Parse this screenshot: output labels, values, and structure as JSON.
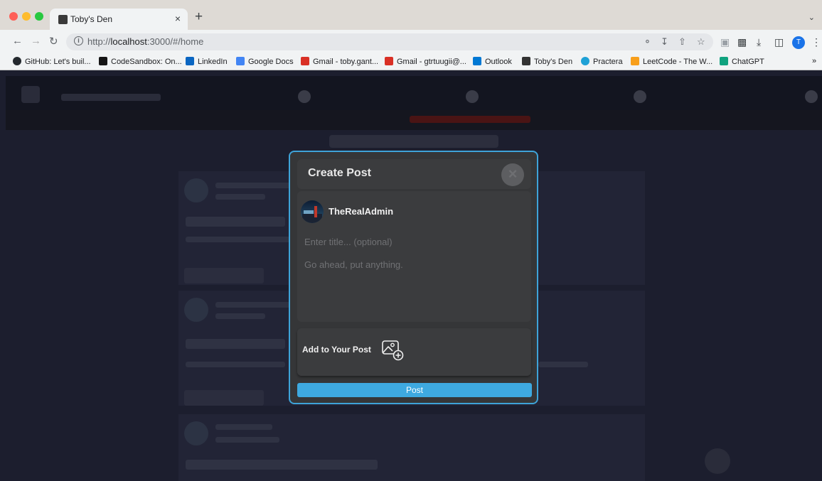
{
  "browser": {
    "tab_title": "Toby's Den",
    "tab_close": "×",
    "new_tab": "+",
    "url_prefix": "http://",
    "url_host": "localhost",
    "url_path": ":3000/#/home",
    "bookmarks": [
      {
        "label": "GitHub: Let's buil...",
        "icon": "github-icon",
        "color": "#24292e"
      },
      {
        "label": "CodeSandbox: On...",
        "icon": "codesandbox-icon",
        "color": "#151515"
      },
      {
        "label": "LinkedIn",
        "icon": "linkedin-icon",
        "color": "#0a66c2"
      },
      {
        "label": "Google Docs",
        "icon": "google-docs-icon",
        "color": "#4285f4"
      },
      {
        "label": "Gmail - toby.gant...",
        "icon": "gmail-icon",
        "color": "#d93025"
      },
      {
        "label": "Gmail - gtrtuugii@...",
        "icon": "gmail-icon",
        "color": "#d93025"
      },
      {
        "label": "Outlook",
        "icon": "outlook-icon",
        "color": "#0078d4"
      },
      {
        "label": "Toby's Den",
        "icon": "tobys-den-icon",
        "color": "#333333"
      },
      {
        "label": "Practera",
        "icon": "practera-icon",
        "color": "#1ea1d6"
      },
      {
        "label": "LeetCode - The W...",
        "icon": "leetcode-icon",
        "color": "#f89f1b"
      },
      {
        "label": "ChatGPT",
        "icon": "chatgpt-icon",
        "color": "#10a37f"
      }
    ],
    "bookmarks_overflow": "»",
    "profile_initial": "T"
  },
  "modal": {
    "title": "Create Post",
    "close_icon": "×",
    "username": "TheRealAdmin",
    "title_placeholder": "Enter title... (optional)",
    "body_placeholder": "Go ahead, put anything.",
    "add_to_post_label": "Add to Your Post",
    "post_button": "Post",
    "accent_color": "#3ea9e0"
  }
}
